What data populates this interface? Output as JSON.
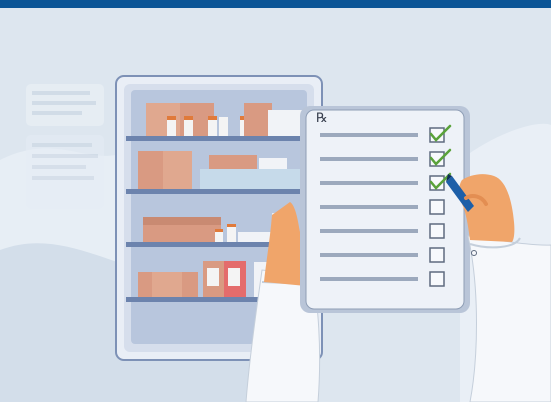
{
  "top_bar": {
    "color": "#0b5596"
  },
  "prescription": {
    "symbol": "℞",
    "items": [
      {
        "checked": true
      },
      {
        "checked": true
      },
      {
        "checked": true
      },
      {
        "checked": false
      },
      {
        "checked": false
      },
      {
        "checked": false
      },
      {
        "checked": false
      }
    ]
  },
  "colors": {
    "background": "#dde6ef",
    "cabinet_frame": "#7d91b6",
    "shelf": "#6c83ad",
    "box": "#d99a82",
    "checkmark": "#5aa23a",
    "pen": "#1d5fa8",
    "skin": "#f0a56a"
  },
  "icons": {
    "medicine_cabinet": "medicine-cabinet-icon",
    "clipboard": "clipboard-icon",
    "checkbox": "checkbox-icon",
    "pen": "pen-icon"
  }
}
